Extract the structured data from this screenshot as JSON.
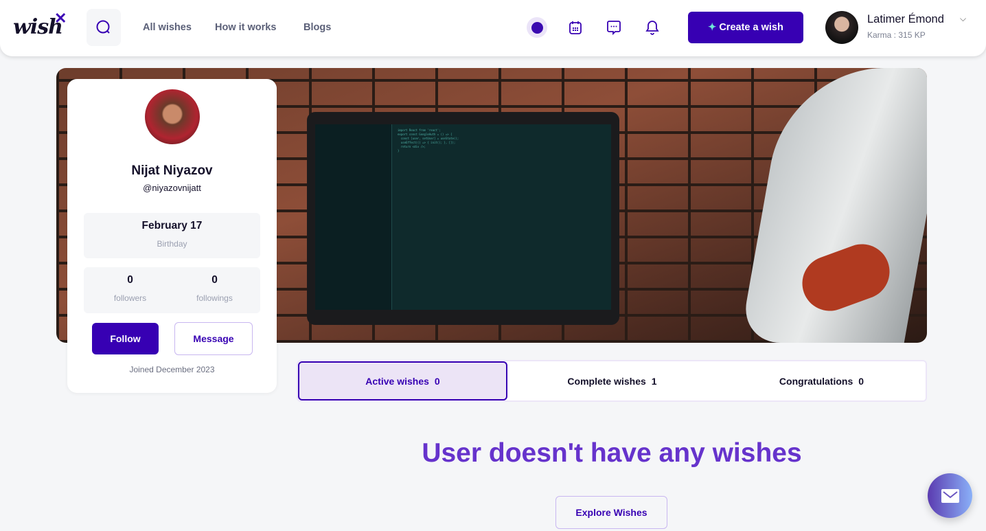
{
  "header": {
    "logo": "wish",
    "nav": [
      "All wishes",
      "How it works",
      "Blogs"
    ],
    "create_label": "Create a wish",
    "user": {
      "name": "Latimer Émond",
      "karma": "Karma : 315 KP"
    }
  },
  "profile": {
    "name": "Nijat Niyazov",
    "handle": "@niyazovnijatt",
    "birthday": "February 17",
    "birthday_label": "Birthday",
    "followers": "0",
    "followers_label": "followers",
    "followings": "0",
    "followings_label": "followings",
    "follow_label": "Follow",
    "message_label": "Message",
    "joined": "Joined December 2023"
  },
  "tabs": [
    {
      "label": "Active wishes",
      "count": "0"
    },
    {
      "label": "Complete wishes",
      "count": "1"
    },
    {
      "label": "Congratulations",
      "count": "0"
    }
  ],
  "empty": {
    "title": "User doesn't have any wishes",
    "button": "Explore Wishes"
  },
  "colors": {
    "brand": "#3700b3",
    "accent": "#6633cc"
  }
}
